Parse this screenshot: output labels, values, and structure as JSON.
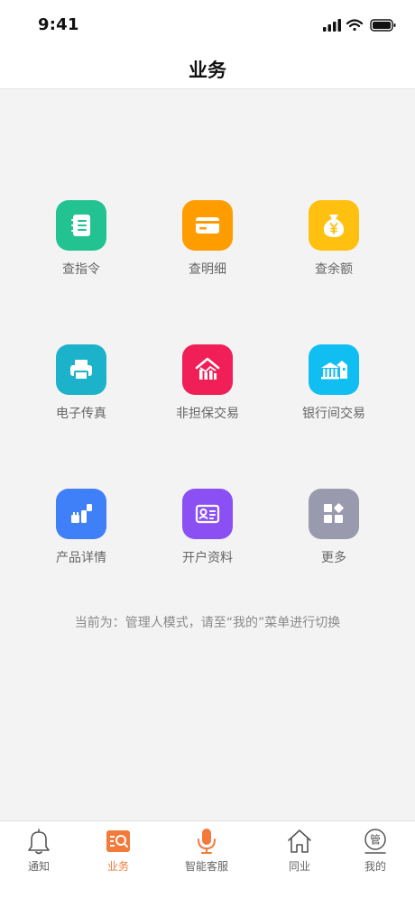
{
  "status_bar": {
    "time": "9:41"
  },
  "nav": {
    "title": "业务"
  },
  "grid": [
    {
      "label": "查指令",
      "icon": "notebook-icon",
      "color": "#22c391"
    },
    {
      "label": "查明细",
      "icon": "card-icon",
      "color": "#ff9c00"
    },
    {
      "label": "查余额",
      "icon": "money-bag-icon",
      "color": "#ffc010"
    },
    {
      "label": "电子传真",
      "icon": "printer-icon",
      "color": "#1cb2c9"
    },
    {
      "label": "非担保交易",
      "icon": "house-chart-icon",
      "color": "#f01f57"
    },
    {
      "label": "银行间交易",
      "icon": "bank-icon",
      "color": "#11bef2"
    },
    {
      "label": "产品详情",
      "icon": "product-icon",
      "color": "#3f7ff7"
    },
    {
      "label": "开户资料",
      "icon": "id-card-icon",
      "color": "#8b50f4"
    },
    {
      "label": "更多",
      "icon": "more-grid-icon",
      "color": "#9a9aae"
    }
  ],
  "mode_note": "当前为：管理人模式，请至“我的”菜单进行切换",
  "tabs": [
    {
      "label": "通知",
      "icon": "bell-icon",
      "active": false
    },
    {
      "label": "业务",
      "icon": "business-search-icon",
      "active": true
    },
    {
      "label": "智能客服",
      "icon": "microphone-icon",
      "active": false
    },
    {
      "label": "同业",
      "icon": "home-icon",
      "active": false
    },
    {
      "label": "我的",
      "icon": "manager-badge-icon",
      "active": false
    }
  ],
  "tab_icon_text": {
    "mine": "管"
  },
  "colors": {
    "accent": "#f27a3a"
  }
}
